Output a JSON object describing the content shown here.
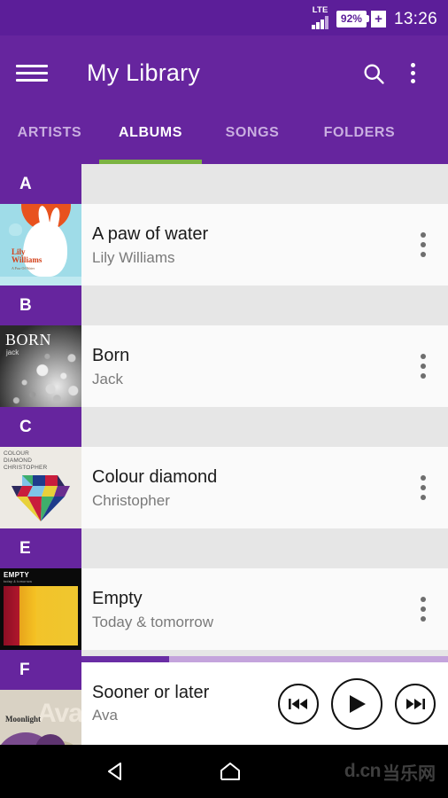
{
  "statusbar": {
    "network": "LTE",
    "battery_percent": "92%",
    "charging_symbol": "+",
    "time": "13:26"
  },
  "appbar": {
    "title": "My Library",
    "menu_icon": "hamburger-menu-icon",
    "search_icon": "search-icon",
    "overflow_icon": "more-vertical-icon"
  },
  "tabs": {
    "items": [
      {
        "label": "ARTISTS",
        "active": false
      },
      {
        "label": "ALBUMS",
        "active": true
      },
      {
        "label": "SONGS",
        "active": false
      },
      {
        "label": "FOLDERS",
        "active": false
      }
    ],
    "indicator_color": "#7CB342"
  },
  "sections": [
    {
      "letter": "A",
      "albums": [
        {
          "title": "A paw of water",
          "artist": "Lily Williams",
          "art": "paw",
          "art_text_primary": "Lily Williams",
          "art_text_secondary": "A Paw Of Water"
        }
      ]
    },
    {
      "letter": "B",
      "albums": [
        {
          "title": "Born",
          "artist": "Jack",
          "art": "born",
          "art_text_primary": "BORN",
          "art_text_secondary": "jack"
        }
      ]
    },
    {
      "letter": "C",
      "albums": [
        {
          "title": "Colour diamond",
          "artist": "Christopher",
          "art": "diamond",
          "art_text_primary": "COLOUR DIAMOND CHRISTOPHER",
          "art_text_secondary": ""
        }
      ]
    },
    {
      "letter": "E",
      "albums": [
        {
          "title": "Empty",
          "artist": "Today & tomorrow",
          "art": "empty",
          "art_text_primary": "EMPTY",
          "art_text_secondary": "today & tomorrow"
        }
      ]
    },
    {
      "letter": "F",
      "albums": [
        {
          "title": "Sooner or later",
          "artist": "Ava",
          "art": "ava",
          "art_text_primary": "Ava",
          "art_text_secondary": "Moonlight"
        }
      ]
    }
  ],
  "player": {
    "title": "Sooner or later",
    "artist": "Ava",
    "progress_percent": 24,
    "previous_icon": "skip-previous-icon",
    "play_icon": "play-icon",
    "next_icon": "skip-next-icon"
  },
  "navbar": {
    "back_icon": "back-triangle-icon",
    "home_icon": "home-icon",
    "watermark_latin": "d.cn",
    "watermark_chinese": "当乐网"
  },
  "colors": {
    "primary_purple": "#66259E",
    "status_purple": "#5C1E99",
    "accent_green": "#7CB342",
    "list_background": "#E6E6E6",
    "row_background": "#FAFAFA"
  }
}
